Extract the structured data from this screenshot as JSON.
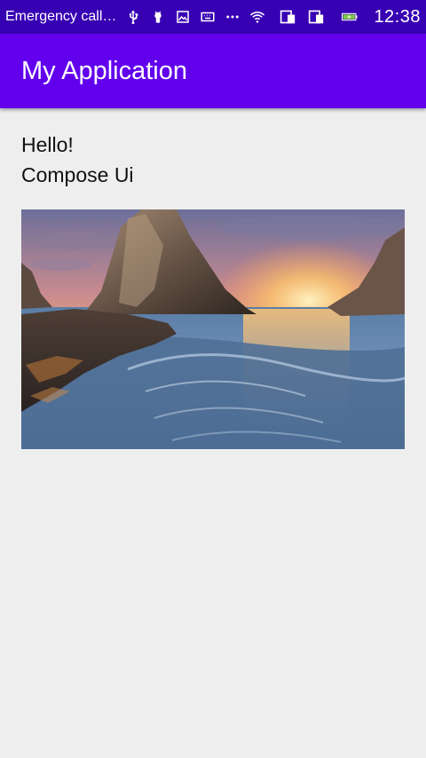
{
  "status_bar": {
    "carrier": "Emergency call…",
    "time": "12:38",
    "icons": [
      "usb-icon",
      "android-debug-icon",
      "image-icon",
      "keyboard-icon",
      "more-icon",
      "wifi-icon",
      "sim1-icon",
      "sim2-icon",
      "battery-charging-icon"
    ],
    "colors": {
      "background": "#3700b3"
    }
  },
  "app_bar": {
    "title": "My Application",
    "colors": {
      "background": "#6200ee"
    }
  },
  "main": {
    "lines": [
      "Hello!",
      "Compose Ui"
    ],
    "image_subject": "coastal sunset with sea stack rock"
  },
  "theme": {
    "background": "#eeeeee",
    "text": "#111111"
  }
}
